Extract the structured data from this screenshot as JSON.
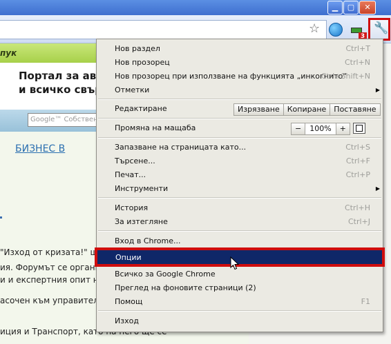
{
  "window": {
    "min_glyph": "▁",
    "max_glyph": "▢",
    "close_glyph": "✕"
  },
  "toolbar": {
    "star_glyph": "☆",
    "wrench_glyph": "🔧",
    "badge_count": "3"
  },
  "page": {
    "header_fragment": "пук",
    "banner_line1": "Портал за авто",
    "banner_line2": "и всичко свърз",
    "search_placeholder": "Google™ Собственс",
    "biz_link": "БИЗНЕС В",
    "lines": [
      "\"Изход от кризата!\" ще се",
      "ия. Форумът се организи",
      "и и експертния опит на с",
      "",
      "асочен към управители и",
      "иция и Транспорт, като на него ще се"
    ]
  },
  "menu": {
    "items": [
      {
        "label": "Нов раздел",
        "shortcut": "Ctrl+T"
      },
      {
        "label": "Нов прозорец",
        "shortcut": "Ctrl+N"
      },
      {
        "label": "Нов прозорец при използване на функцията „инкогнито“",
        "shortcut": "Ctrl+Shift+N"
      },
      {
        "label": "Отметки",
        "shortcut": ""
      }
    ],
    "edit": {
      "label": "Редактиране",
      "cut": "Изрязване",
      "copy": "Копиране",
      "paste": "Поставяне"
    },
    "zoom": {
      "label": "Промяна на мащаба",
      "minus": "−",
      "value": "100%",
      "plus": "+"
    },
    "items2": [
      {
        "label": "Запазване на страницата като...",
        "shortcut": "Ctrl+S"
      },
      {
        "label": "Търсене...",
        "shortcut": "Ctrl+F"
      },
      {
        "label": "Печат...",
        "shortcut": "Ctrl+P"
      },
      {
        "label": "Инструменти",
        "shortcut": ""
      }
    ],
    "items3": [
      {
        "label": "История",
        "shortcut": "Ctrl+H"
      },
      {
        "label": "За изтегляне",
        "shortcut": "Ctrl+J"
      }
    ],
    "signin": "Вход в Chrome...",
    "options": "Опции",
    "items4": [
      {
        "label": "Всичко за Google Chrome",
        "shortcut": ""
      },
      {
        "label": "Преглед на фоновите страници (2)",
        "shortcut": ""
      },
      {
        "label": "Помощ",
        "shortcut": "F1"
      }
    ],
    "exit": "Изход",
    "submenu_arrow": "▶"
  }
}
